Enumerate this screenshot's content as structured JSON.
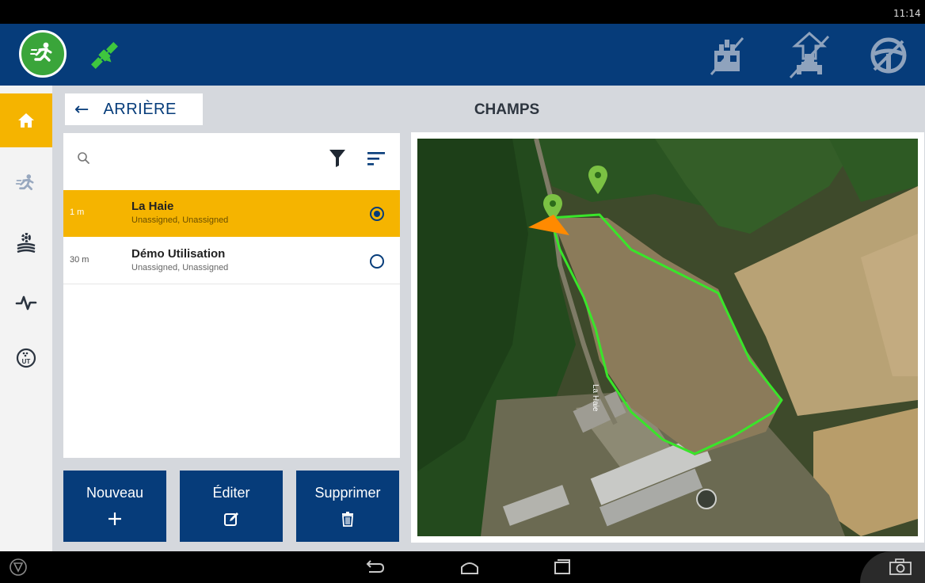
{
  "status_bar": {
    "time": "11:14"
  },
  "app_bar": {
    "run_icon": "running-person-icon",
    "gps_icon": "satellite-icon",
    "right_icons": [
      "implement-disabled-icon",
      "autosteer-disabled-icon",
      "steering-wheel-disabled-icon"
    ]
  },
  "side_nav": {
    "items": [
      {
        "icon": "home-icon",
        "active": true
      },
      {
        "icon": "running-person-icon",
        "active": false
      },
      {
        "icon": "field-settings-icon",
        "active": false
      },
      {
        "icon": "diagnostics-icon",
        "active": false
      },
      {
        "icon": "isobus-ut-icon",
        "active": false
      }
    ]
  },
  "header": {
    "back_label": "ARRIÈRE",
    "title": "CHAMPS"
  },
  "search": {
    "value": "",
    "placeholder": ""
  },
  "fields": [
    {
      "distance": "1 m",
      "name": "La Haie",
      "subtitle": "Unassigned, Unassigned",
      "selected": true
    },
    {
      "distance": "30 m",
      "name": "Démo Utilisation",
      "subtitle": "Unassigned, Unassigned",
      "selected": false
    }
  ],
  "actions": {
    "new_label": "Nouveau",
    "edit_label": "Éditer",
    "delete_label": "Supprimer"
  },
  "map": {
    "road_label": "La Haie"
  },
  "colors": {
    "primary": "#063c7a",
    "accent": "#f5b400",
    "gps_ok": "#3ec63e",
    "boundary": "#39e52a",
    "vehicle": "#ff8a00"
  }
}
